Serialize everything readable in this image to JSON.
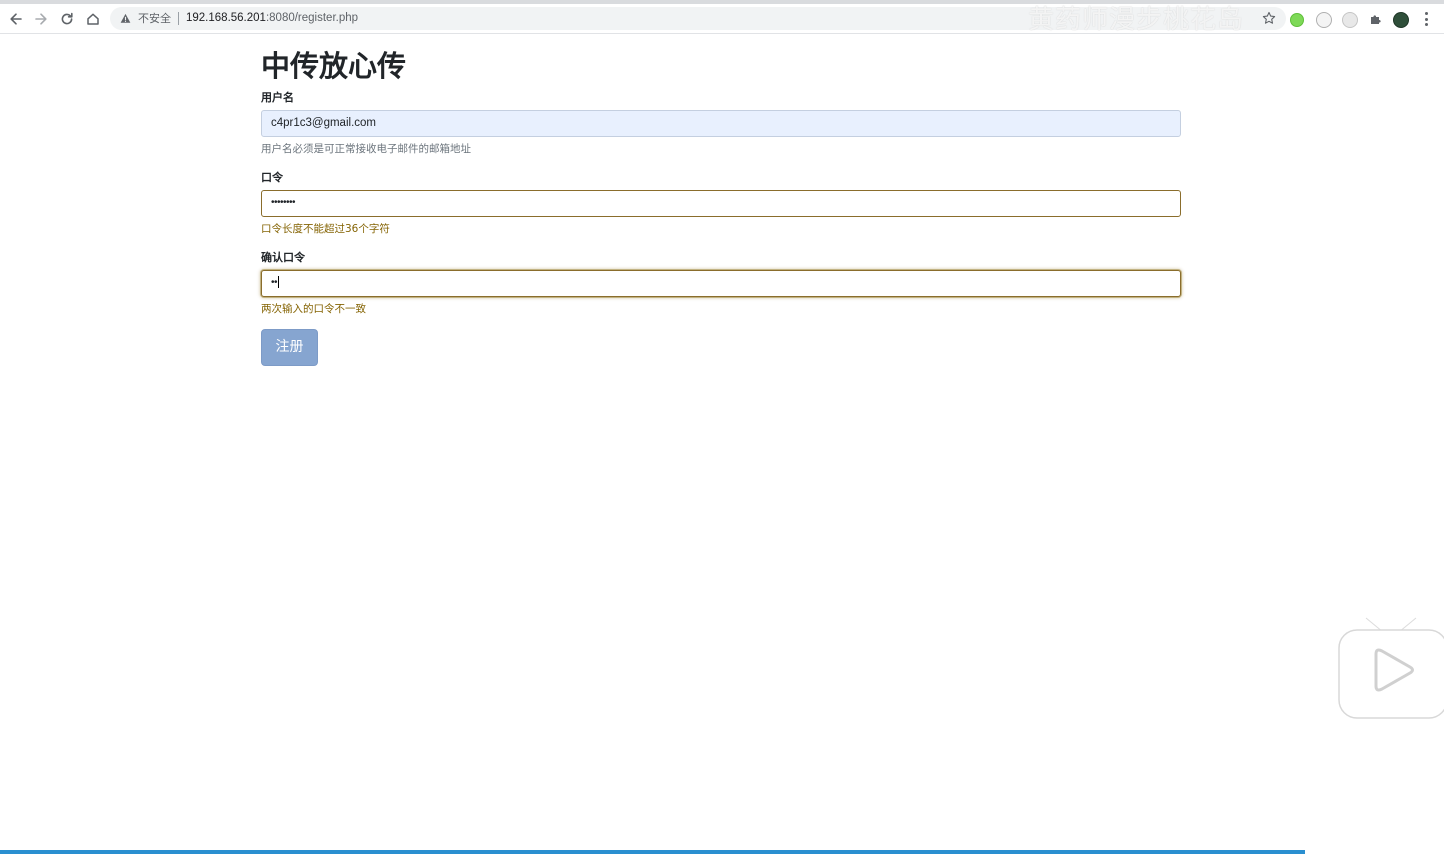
{
  "browser": {
    "security_label": "不安全",
    "url_host": "192.168.56.201",
    "url_rest": ":8080/register.php",
    "watermark": "黄药师漫步桃花岛"
  },
  "page": {
    "title": "中传放心传"
  },
  "form": {
    "username": {
      "label": "用户名",
      "value": "c4pr1c3@gmail.com",
      "help": "用户名必须是可正常接收电子邮件的邮箱地址"
    },
    "password": {
      "label": "口令",
      "masked_value": "••••••••",
      "help": "口令长度不能超过36个字符"
    },
    "confirm": {
      "label": "确认口令",
      "masked_value": "••",
      "help": "两次输入的口令不一致"
    },
    "submit_label": "注册"
  },
  "icons": {
    "back": "arrow-left-icon",
    "forward": "arrow-right-icon",
    "reload": "reload-icon",
    "home": "home-icon",
    "warning": "warning-triangle-icon",
    "bookmark": "star-icon",
    "menu": "kebab-menu-icon",
    "player": "play-tv-icon"
  },
  "colors": {
    "submit_button": "#86a5d0",
    "warning_text": "#856404",
    "progress_bar": "#2a8fd0",
    "autofill_bg": "#e8f0fe"
  },
  "video_progress": 0.904
}
